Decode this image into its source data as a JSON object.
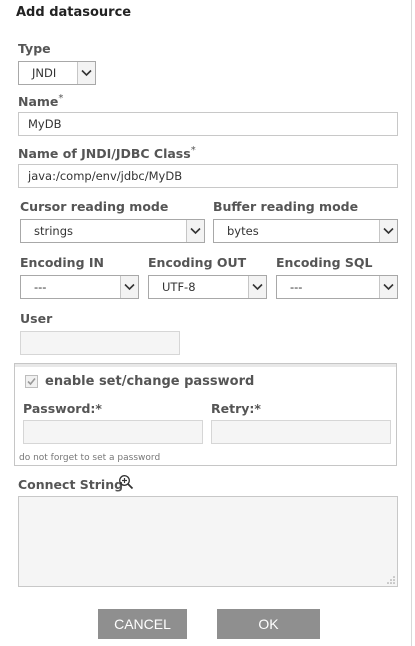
{
  "dialog": {
    "title": "Add datasource",
    "required_mark": "*"
  },
  "type": {
    "label": "Type",
    "value": "JNDI"
  },
  "name": {
    "label": "Name",
    "value": "MyDB"
  },
  "class_name": {
    "label": "Name of JNDI/JDBC Class",
    "value": "java:/comp/env/jdbc/MyDB"
  },
  "cursor_mode": {
    "label": "Cursor reading mode",
    "value": "strings"
  },
  "buffer_mode": {
    "label": "Buffer reading mode",
    "value": "bytes"
  },
  "encoding_in": {
    "label": "Encoding IN",
    "value": "---"
  },
  "encoding_out": {
    "label": "Encoding OUT",
    "value": "UTF-8"
  },
  "encoding_sql": {
    "label": "Encoding SQL",
    "value": "---"
  },
  "user": {
    "label": "User",
    "value": ""
  },
  "password_section": {
    "checkbox_label": "enable set/change password",
    "checked": true,
    "password_label": "Password:*",
    "retry_label": "Retry:*",
    "hint": "do not forget to set a password"
  },
  "connect_string": {
    "label": "Connect String",
    "value": ""
  },
  "buttons": {
    "cancel": "CANCEL",
    "ok": "OK"
  },
  "colors": {
    "button_bg": "#8f8f8f",
    "label_text": "#555555",
    "border": "#c8c8c8"
  }
}
